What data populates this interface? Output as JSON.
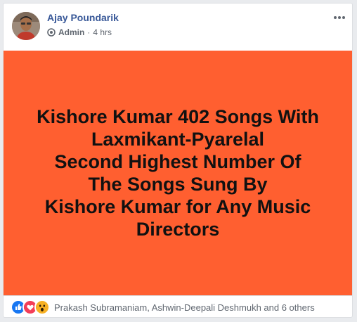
{
  "post": {
    "author": "Ajay Poundarik",
    "role": "Admin",
    "separator": "·",
    "time": "4 hrs",
    "more_icon": "ellipsis-icon",
    "banner_color": "#ff5f30",
    "banner_lines": [
      "Kishore Kumar 402 Songs With",
      "Laxmikant-Pyarelal",
      "Second Highest Number Of",
      "The Songs Sung By",
      "Kishore Kumar for Any Music",
      "Directors"
    ],
    "reactions": [
      "like-icon",
      "love-icon",
      "wow-icon"
    ],
    "likers_text": "Prakash Subramaniam, Ashwin-Deepali Deshmukh and 6 others"
  }
}
